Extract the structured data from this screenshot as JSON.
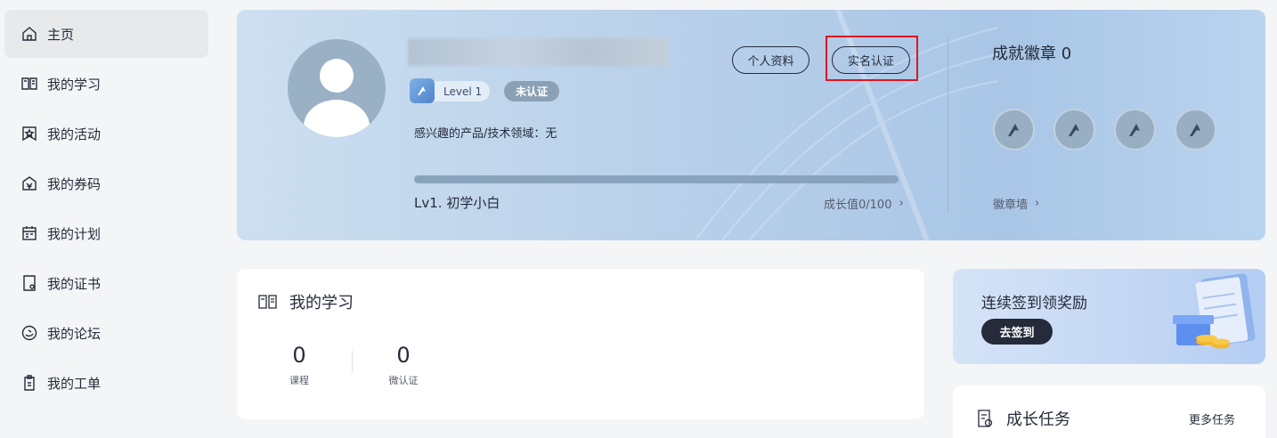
{
  "sidebar": {
    "items": [
      {
        "label": "主页",
        "icon": "home-icon",
        "active": true
      },
      {
        "label": "我的学习",
        "icon": "book-icon"
      },
      {
        "label": "我的活动",
        "icon": "activity-icon"
      },
      {
        "label": "我的券码",
        "icon": "coupon-icon"
      },
      {
        "label": "我的计划",
        "icon": "calendar-icon"
      },
      {
        "label": "我的证书",
        "icon": "certificate-icon"
      },
      {
        "label": "我的论坛",
        "icon": "forum-icon"
      },
      {
        "label": "我的工单",
        "icon": "clipboard-icon"
      }
    ]
  },
  "profile": {
    "level_badge": "Level 1",
    "auth_status": "未认证",
    "interests": "感兴趣的产品/技术领域：无",
    "profile_button": "个人资料",
    "realname_button": "实名认证",
    "level_title": "Lv1. 初学小白",
    "growth_value": "成长值0/100",
    "progress": 0
  },
  "badges": {
    "title": "成就徽章 0",
    "wall_link": "徽章墙"
  },
  "learning": {
    "title": "我的学习",
    "stats": [
      {
        "value": "0",
        "label": "课程"
      },
      {
        "value": "0",
        "label": "微认证"
      }
    ]
  },
  "signin": {
    "title": "连续签到领奖励",
    "button": "去签到"
  },
  "tasks": {
    "title": "成长任务",
    "more": "更多任务"
  },
  "colors": {
    "text": "#252b3a",
    "highlight": "#e0141e",
    "banner": "#b7cfe9"
  }
}
